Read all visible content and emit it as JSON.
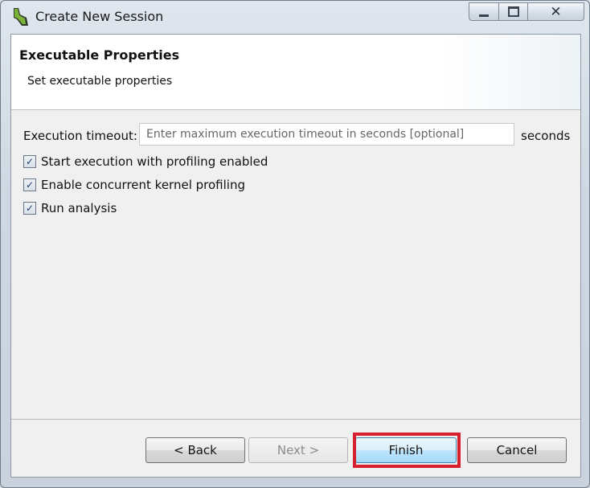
{
  "window": {
    "title": "Create New Session",
    "controls": {
      "minimize_icon": "minimize-icon",
      "maximize_icon": "maximize-icon",
      "close_icon": "close-icon",
      "close_glyph": "✕"
    }
  },
  "header": {
    "title": "Executable Properties",
    "subtitle": "Set executable properties"
  },
  "form": {
    "timeout_label": "Execution timeout:",
    "timeout_value": "",
    "timeout_placeholder": "Enter maximum execution timeout in seconds [optional]",
    "timeout_unit": "seconds",
    "checkboxes": [
      {
        "label": "Start execution with profiling enabled",
        "checked": true
      },
      {
        "label": "Enable concurrent kernel profiling",
        "checked": true
      },
      {
        "label": "Run analysis",
        "checked": true
      }
    ],
    "check_glyph": "✓"
  },
  "buttons": {
    "back": "< Back",
    "next": "Next >",
    "finish": "Finish",
    "cancel": "Cancel"
  },
  "colors": {
    "highlight": "#d7202e",
    "finish_border": "#3c7fb1"
  }
}
